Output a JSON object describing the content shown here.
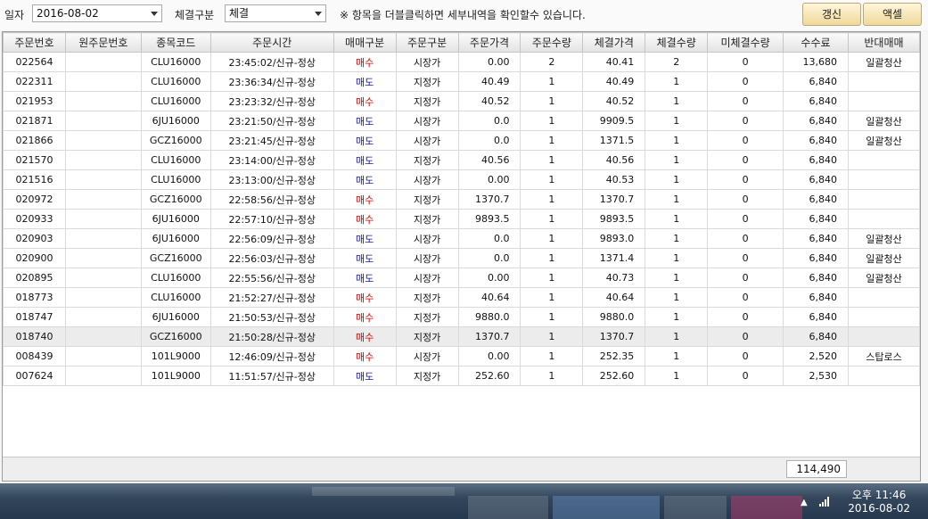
{
  "toolbar": {
    "date_label": "일자",
    "date_value": "2016-08-02",
    "type_label": "체결구분",
    "type_value": "체결",
    "notice": "※ 항목을 더블클릭하면 세부내역을 확인할수 있습니다.",
    "refresh_label": "갱신",
    "excel_label": "액셀"
  },
  "table": {
    "headers": [
      "주문번호",
      "원주문번호",
      "종목코드",
      "주문시간",
      "매매구분",
      "주문구분",
      "주문가격",
      "주문수량",
      "체결가격",
      "체결수량",
      "미체결수량",
      "수수료",
      "반대매매"
    ],
    "rows": [
      [
        "022564",
        "",
        "CLU16000",
        "23:45:02/신규-정상",
        "매수",
        "시장가",
        "0.00",
        "2",
        "40.41",
        "2",
        "0",
        "13,680",
        "일괄청산"
      ],
      [
        "022311",
        "",
        "CLU16000",
        "23:36:34/신규-정상",
        "매도",
        "지정가",
        "40.49",
        "1",
        "40.49",
        "1",
        "0",
        "6,840",
        ""
      ],
      [
        "021953",
        "",
        "CLU16000",
        "23:23:32/신규-정상",
        "매수",
        "지정가",
        "40.52",
        "1",
        "40.52",
        "1",
        "0",
        "6,840",
        ""
      ],
      [
        "021871",
        "",
        "6JU16000",
        "23:21:50/신규-정상",
        "매도",
        "시장가",
        "0.0",
        "1",
        "9909.5",
        "1",
        "0",
        "6,840",
        "일괄청산"
      ],
      [
        "021866",
        "",
        "GCZ16000",
        "23:21:45/신규-정상",
        "매도",
        "시장가",
        "0.0",
        "1",
        "1371.5",
        "1",
        "0",
        "6,840",
        "일괄청산"
      ],
      [
        "021570",
        "",
        "CLU16000",
        "23:14:00/신규-정상",
        "매도",
        "지정가",
        "40.56",
        "1",
        "40.56",
        "1",
        "0",
        "6,840",
        ""
      ],
      [
        "021516",
        "",
        "CLU16000",
        "23:13:00/신규-정상",
        "매도",
        "시장가",
        "0.00",
        "1",
        "40.53",
        "1",
        "0",
        "6,840",
        ""
      ],
      [
        "020972",
        "",
        "GCZ16000",
        "22:58:56/신규-정상",
        "매수",
        "지정가",
        "1370.7",
        "1",
        "1370.7",
        "1",
        "0",
        "6,840",
        ""
      ],
      [
        "020933",
        "",
        "6JU16000",
        "22:57:10/신규-정상",
        "매수",
        "지정가",
        "9893.5",
        "1",
        "9893.5",
        "1",
        "0",
        "6,840",
        ""
      ],
      [
        "020903",
        "",
        "6JU16000",
        "22:56:09/신규-정상",
        "매도",
        "시장가",
        "0.0",
        "1",
        "9893.0",
        "1",
        "0",
        "6,840",
        "일괄청산"
      ],
      [
        "020900",
        "",
        "GCZ16000",
        "22:56:03/신규-정상",
        "매도",
        "시장가",
        "0.0",
        "1",
        "1371.4",
        "1",
        "0",
        "6,840",
        "일괄청산"
      ],
      [
        "020895",
        "",
        "CLU16000",
        "22:55:56/신규-정상",
        "매도",
        "시장가",
        "0.00",
        "1",
        "40.73",
        "1",
        "0",
        "6,840",
        "일괄청산"
      ],
      [
        "018773",
        "",
        "CLU16000",
        "21:52:27/신규-정상",
        "매수",
        "지정가",
        "40.64",
        "1",
        "40.64",
        "1",
        "0",
        "6,840",
        ""
      ],
      [
        "018747",
        "",
        "6JU16000",
        "21:50:53/신규-정상",
        "매수",
        "지정가",
        "9880.0",
        "1",
        "9880.0",
        "1",
        "0",
        "6,840",
        ""
      ],
      [
        "018740",
        "",
        "GCZ16000",
        "21:50:28/신규-정상",
        "매수",
        "지정가",
        "1370.7",
        "1",
        "1370.7",
        "1",
        "0",
        "6,840",
        ""
      ],
      [
        "008439",
        "",
        "101L9000",
        "12:46:09/신규-정상",
        "매수",
        "시장가",
        "0.00",
        "1",
        "252.35",
        "1",
        "0",
        "2,520",
        "스탑로스"
      ],
      [
        "007624",
        "",
        "101L9000",
        "11:51:57/신규-정상",
        "매도",
        "지정가",
        "252.60",
        "1",
        "252.60",
        "1",
        "0",
        "2,530",
        ""
      ]
    ],
    "selected_row": 14
  },
  "footer": {
    "total_fee": "114,490"
  },
  "taskbar": {
    "clock_time": "오후 11:46",
    "clock_date": "2016-08-02"
  },
  "colors": {
    "buy": "#cc0000",
    "sell": "#1a1a9a",
    "button_gradient_top": "#fff6d9",
    "button_gradient_bottom": "#efd89a"
  }
}
